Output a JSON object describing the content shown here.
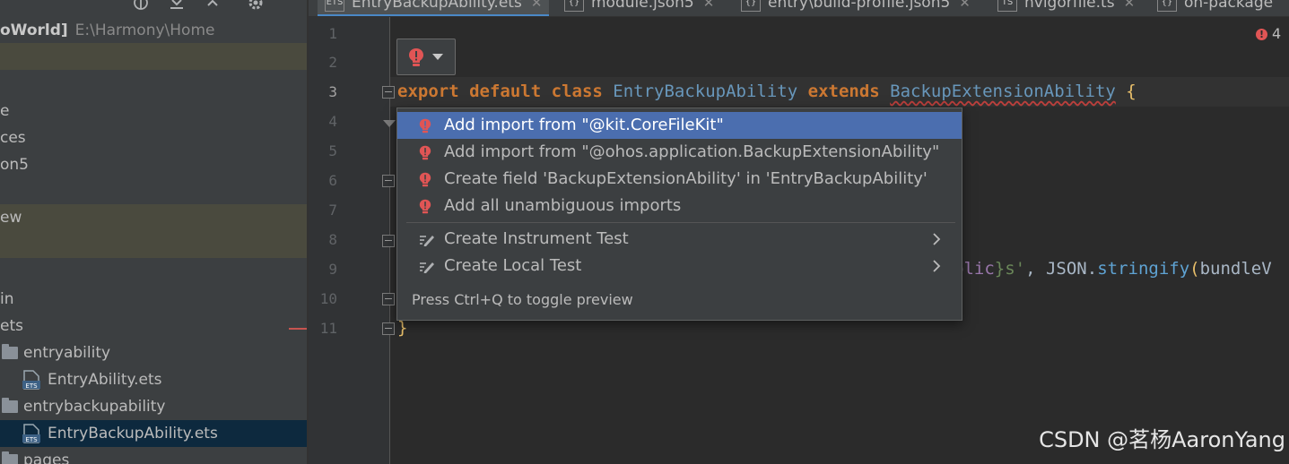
{
  "project_panel": {
    "root_label": "oWorld]",
    "root_path": "E:\\Harmony\\Home",
    "rows": [
      {
        "label": "e"
      },
      {
        "label": "ces"
      },
      {
        "label": "on5"
      },
      {
        "label": "ew"
      },
      {
        "label": "in"
      },
      {
        "label": "ets"
      },
      {
        "label": "entryability"
      },
      {
        "label": "EntryAbility.ets"
      },
      {
        "label": "entrybackupability"
      },
      {
        "label": "EntryBackupAbility.ets"
      },
      {
        "label": "pages"
      }
    ]
  },
  "tabs": [
    {
      "label": "EntryBackupAbility.ets",
      "active": true
    },
    {
      "label": "module.json5"
    },
    {
      "label": "entry\\build-profile.json5"
    },
    {
      "label": "hvigorfile.ts"
    },
    {
      "label": "oh-package"
    }
  ],
  "editor": {
    "line_numbers": [
      "1",
      "2",
      "3",
      "4",
      "5",
      "6",
      "7",
      "8",
      "9",
      "10",
      "11"
    ],
    "error_count": "4",
    "code": {
      "l3_export": "export",
      "l3_default": "default",
      "l3_class": "class",
      "l3_name": "EntryBackupAbility",
      "l3_extends": "extends",
      "l3_base": "BackupExtensionAbility",
      "l3_brace": "{",
      "l9_tail_a": "blic",
      "l9_tail_b": "}s'",
      "l9_tail_c": ", ",
      "l9_json": "JSON",
      "l9_dot": ".",
      "l9_fn": "stringify",
      "l9_paren": "(",
      "l9_arg": "bundleV",
      "l11_brace": "}"
    }
  },
  "intention_popup": {
    "items": [
      {
        "label": "Add import from \"@kit.CoreFileKit\"",
        "icon": "error-bulb-icon"
      },
      {
        "label": "Add import from \"@ohos.application.BackupExtensionAbility\"",
        "icon": "error-bulb-icon"
      },
      {
        "label": "Create field 'BackupExtensionAbility' in 'EntryBackupAbility'",
        "icon": "error-bulb-icon"
      },
      {
        "label": "Add all unambiguous imports",
        "icon": "error-bulb-icon"
      },
      {
        "label": "Create Instrument Test",
        "icon": "edit-pen-icon"
      },
      {
        "label": "Create Local Test",
        "icon": "edit-pen-icon"
      }
    ],
    "hint": "Press Ctrl+Q to toggle preview"
  },
  "watermark": "CSDN @茗杨AaronYang",
  "colors": {
    "background": "#2b2b2b",
    "panel": "#3c3f41",
    "selection": "#4b6eaf",
    "keyword": "#cc7832",
    "error": "#e05555"
  }
}
